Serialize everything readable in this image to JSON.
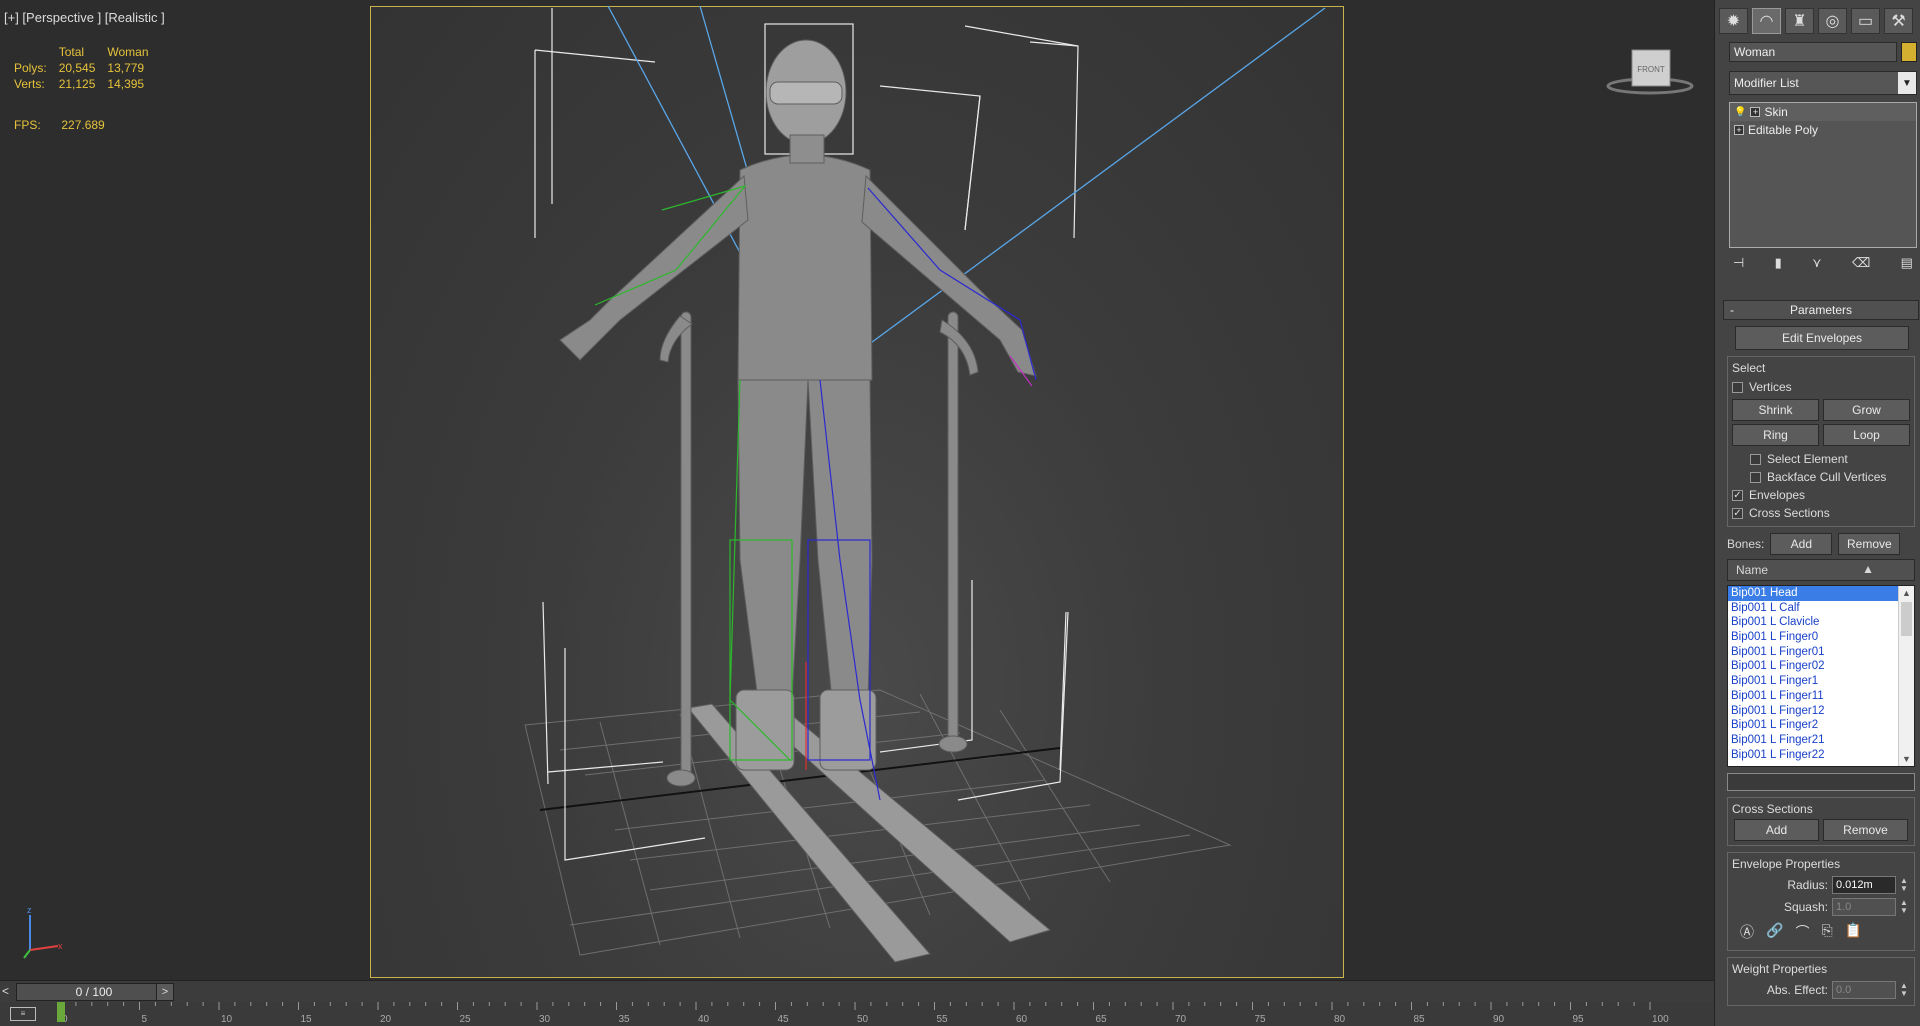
{
  "viewport": {
    "label": "[+] [Perspective ] [Realistic ]",
    "stats": {
      "headers": [
        "Total",
        "Woman"
      ],
      "rows": [
        {
          "label": "Polys:",
          "total": "20,545",
          "object": "13,779"
        },
        {
          "label": "Verts:",
          "total": "21,125",
          "object": "14,395"
        }
      ]
    },
    "fps_label": "FPS:",
    "fps_value": "227.689",
    "viewcube_label": "FRONT",
    "axis": {
      "z": "z",
      "x": "x"
    }
  },
  "command_panel": {
    "tabs": [
      "create-icon",
      "modify-icon",
      "hierarchy-icon",
      "motion-icon",
      "display-icon",
      "utilities-icon"
    ],
    "object_name": "Woman",
    "object_color": "#d4b030",
    "modifier_list": "Modifier List",
    "stack": [
      {
        "label": "Skin",
        "selected": true
      },
      {
        "label": "Editable Poly",
        "selected": false
      }
    ],
    "parameters": {
      "title": "Parameters",
      "edit_envelopes": "Edit Envelopes",
      "select": {
        "title": "Select",
        "vertices": "Vertices",
        "shrink": "Shrink",
        "grow": "Grow",
        "ring": "Ring",
        "loop": "Loop",
        "select_element": "Select Element",
        "backface_cull": "Backface Cull Vertices",
        "envelopes": "Envelopes",
        "cross_sections": "Cross Sections"
      },
      "bones": {
        "label": "Bones:",
        "add": "Add",
        "remove": "Remove",
        "name_header": "Name",
        "list": [
          "Bip001 Head",
          "Bip001 L Calf",
          "Bip001 L Clavicle",
          "Bip001 L Finger0",
          "Bip001 L Finger01",
          "Bip001 L Finger02",
          "Bip001 L Finger1",
          "Bip001 L Finger11",
          "Bip001 L Finger12",
          "Bip001 L Finger2",
          "Bip001 L Finger21",
          "Bip001 L Finger22"
        ]
      },
      "cross_sections": {
        "title": "Cross Sections",
        "add": "Add",
        "remove": "Remove"
      },
      "envelope_properties": {
        "title": "Envelope Properties",
        "radius_label": "Radius:",
        "radius_value": "0.012m",
        "squash_label": "Squash:",
        "squash_value": "1.0"
      },
      "weight_properties": {
        "title": "Weight Properties",
        "abs_effect_label": "Abs. Effect:",
        "abs_effect_value": "0.0"
      }
    }
  },
  "timeline": {
    "frame_display": "0 / 100",
    "ticks": [
      "0",
      "5",
      "10",
      "15",
      "20",
      "25",
      "30",
      "35",
      "40",
      "45",
      "50",
      "55",
      "60",
      "65",
      "70",
      "75",
      "80",
      "85",
      "90",
      "95",
      "100"
    ]
  }
}
